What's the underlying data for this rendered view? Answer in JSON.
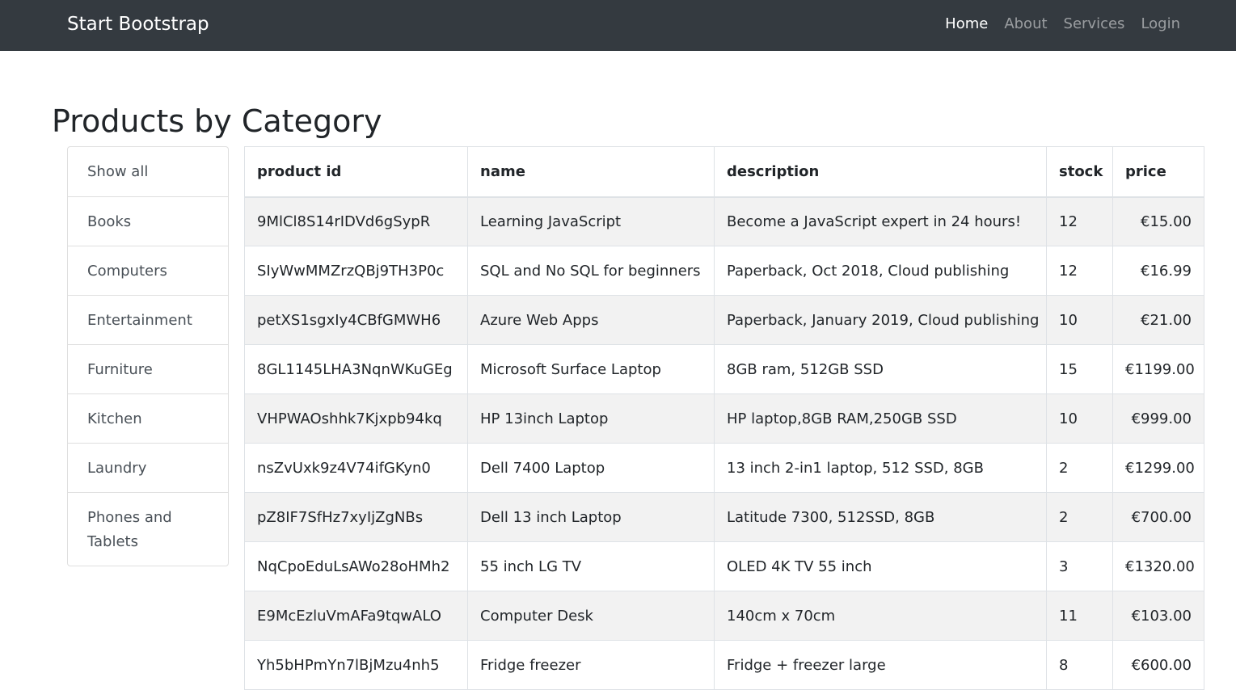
{
  "navbar": {
    "brand": "Start Bootstrap",
    "links": [
      {
        "label": "Home",
        "active": true
      },
      {
        "label": "About",
        "active": false
      },
      {
        "label": "Services",
        "active": false
      },
      {
        "label": "Login",
        "active": false
      }
    ]
  },
  "page": {
    "title": "Products by Category"
  },
  "categories": [
    "Show all",
    "Books",
    "Computers",
    "Entertainment",
    "Furniture",
    "Kitchen",
    "Laundry",
    "Phones and Tablets"
  ],
  "table": {
    "headers": [
      "product id",
      "name",
      "description",
      "stock",
      "price"
    ],
    "rows": [
      [
        "9MlCl8S14rIDVd6gSypR",
        "Learning JavaScript",
        "Become a JavaScript expert in 24 hours!",
        "12",
        "€15.00"
      ],
      [
        "SIyWwMMZrzQBj9TH3P0c",
        "SQL and No SQL for beginners",
        "Paperback, Oct 2018, Cloud publishing",
        "12",
        "€16.99"
      ],
      [
        "petXS1sgxIy4CBfGMWH6",
        "Azure Web Apps",
        "Paperback, January 2019, Cloud publishing",
        "10",
        "€21.00"
      ],
      [
        "8GL1145LHA3NqnWKuGEg",
        "Microsoft Surface Laptop",
        "8GB ram, 512GB SSD",
        "15",
        "€1199.00"
      ],
      [
        "VHPWAOshhk7Kjxpb94kq",
        "HP 13inch Laptop",
        "HP laptop,8GB RAM,250GB SSD",
        "10",
        "€999.00"
      ],
      [
        "nsZvUxk9z4V74ifGKyn0",
        "Dell 7400 Laptop",
        "13 inch 2-in1 laptop, 512 SSD, 8GB",
        "2",
        "€1299.00"
      ],
      [
        "pZ8IF7SfHz7xyIjZgNBs",
        "Dell 13 inch Laptop",
        "Latitude 7300, 512SSD, 8GB",
        "2",
        "€700.00"
      ],
      [
        "NqCpoEduLsAWo28oHMh2",
        "55 inch LG TV",
        "OLED 4K TV 55 inch",
        "3",
        "€1320.00"
      ],
      [
        "E9McEzluVmAFa9tqwALO",
        "Computer Desk",
        "140cm x 70cm",
        "11",
        "€103.00"
      ],
      [
        "Yh5bHPmYn7lBjMzu4nh5",
        "Fridge freezer",
        "Fridge + freezer large",
        "8",
        "€600.00"
      ]
    ]
  }
}
